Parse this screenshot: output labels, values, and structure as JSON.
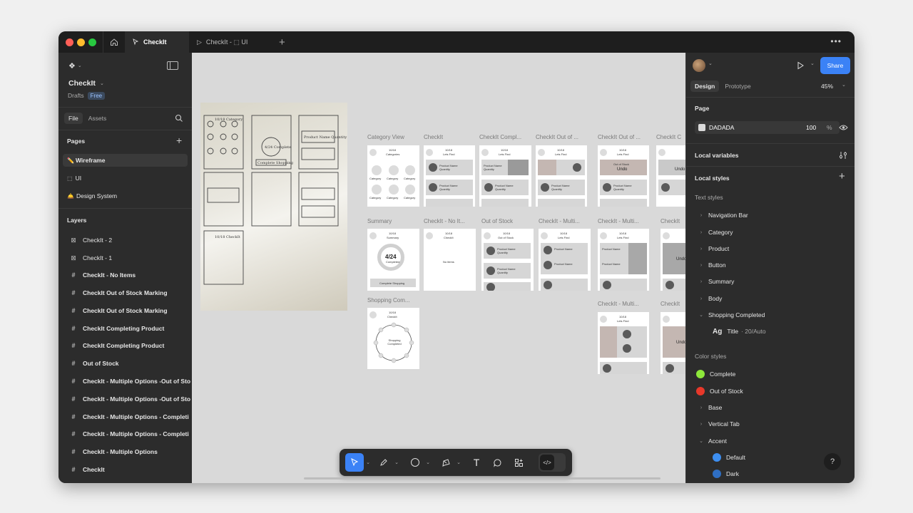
{
  "titlebar": {
    "tabs": [
      {
        "label": "CheckIt",
        "active": true
      },
      {
        "label": "CheckIt - ⬚ UI",
        "active": false
      }
    ],
    "new_tab": "+",
    "more": "•••"
  },
  "left": {
    "file_name": "CheckIt",
    "location": "Drafts",
    "plan_badge": "Free",
    "tabs": {
      "file": "File",
      "assets": "Assets"
    },
    "pages_header": "Pages",
    "pages": [
      {
        "icon": "✏️",
        "label": "Wireframe",
        "selected": true
      },
      {
        "icon": "⬚",
        "label": "UI",
        "selected": false
      },
      {
        "icon": "🛎️",
        "label": "Design System",
        "selected": false
      }
    ],
    "layers_header": "Layers",
    "layers": [
      {
        "icon": "image",
        "label": "CheckIt - 2"
      },
      {
        "icon": "image",
        "label": "CheckIt - 1"
      },
      {
        "icon": "frame",
        "label": "CheckIt - No Items"
      },
      {
        "icon": "frame",
        "label": "CheckIt Out of Stock Marking"
      },
      {
        "icon": "frame",
        "label": "CheckIt Out of Stock Marking"
      },
      {
        "icon": "frame",
        "label": "CheckIt Completing Product"
      },
      {
        "icon": "frame",
        "label": "CheckIt Completing Product"
      },
      {
        "icon": "frame",
        "label": "Out of Stock"
      },
      {
        "icon": "frame",
        "label": "CheckIt - Multiple Options -Out of Sto"
      },
      {
        "icon": "frame",
        "label": "CheckIt - Multiple Options -Out of Sto"
      },
      {
        "icon": "frame",
        "label": "CheckIt - Multiple Options - Completi"
      },
      {
        "icon": "frame",
        "label": "CheckIt - Multiple Options - Completi"
      },
      {
        "icon": "frame",
        "label": "CheckIt - Multiple Options"
      },
      {
        "icon": "frame",
        "label": "CheckIt"
      }
    ]
  },
  "canvas": {
    "frame_labels": {
      "category_view": "Category View",
      "checkit": "CheckIt",
      "checkit_compl": "CheckIt Compl...",
      "checkit_out_a": "CheckIt Out of ...",
      "checkit_out_b": "CheckIt Out of ...",
      "checkit_cut": "CheckIt C",
      "summary": "Summary",
      "checkit_no": "CheckIt - No It...",
      "out_of_stock": "Out of Stock",
      "multi_a": "CheckIt - Multi...",
      "multi_b": "CheckIt - Multi...",
      "checkit_cut2": "CheckIt",
      "shopping": "Shopping Com...",
      "multi_c": "CheckIt - Multi...",
      "checkit_cut3": "CheckIt"
    },
    "mini": {
      "date": "10/18",
      "categories": "Categories",
      "category": "Category",
      "lets_find": "Lets Find",
      "product_name": "Product Name",
      "quantity": "Quantity",
      "summary": "Summary",
      "summary_value": "4/24",
      "completed": "Completed",
      "complete_shopping": "Complete Shopping",
      "checkit": "CheckIt",
      "no_items": "No items",
      "out_of_stock": "Out of Stock",
      "undo": "Undo",
      "shopping_completed": "Shopping Completed",
      "sketch_labels": [
        "10/18 Category",
        "4/24 Complete",
        "Complete Shopping",
        "Product Name Quantity",
        "10/18 CheckIt"
      ]
    }
  },
  "toolbar": {
    "tools": [
      "move-tool",
      "pen-tool",
      "shape-tool",
      "pencil-tool",
      "text-tool",
      "comment-tool",
      "actions-tool",
      "dev-mode-toggle"
    ]
  },
  "right": {
    "share_label": "Share",
    "tabs": {
      "design": "Design",
      "prototype": "Prototype"
    },
    "zoom": "45%",
    "page_header": "Page",
    "page_color": "DADADA",
    "page_opacity": "100",
    "page_opacity_unit": "%",
    "local_variables": "Local variables",
    "local_styles": "Local styles",
    "text_styles_header": "Text styles",
    "text_styles": [
      "Navigation Bar",
      "Category",
      "Product",
      "Button",
      "Summary",
      "Body",
      "Shopping Completed"
    ],
    "text_style_detail": {
      "glyph": "Ag",
      "name": "Title",
      "spec": "· 20/Auto"
    },
    "color_styles_header": "Color styles",
    "color_styles": [
      {
        "label": "Complete",
        "color": "#8ee83b",
        "type": "swatch"
      },
      {
        "label": "Out of Stock",
        "color": "#e8382a",
        "type": "swatch"
      },
      {
        "label": "Base",
        "type": "group"
      },
      {
        "label": "Vertical Tab",
        "type": "group"
      },
      {
        "label": "Accent",
        "type": "group-open"
      },
      {
        "label": "Default",
        "color": "#3d8ef0",
        "type": "swatch-nested"
      },
      {
        "label": "Dark",
        "color": "#2f6fc4",
        "type": "swatch-nested"
      }
    ],
    "help": "?"
  },
  "colors": {
    "accent": "#3b82f6",
    "panel": "#2c2c2c",
    "canvas": "#d9d9d9"
  }
}
